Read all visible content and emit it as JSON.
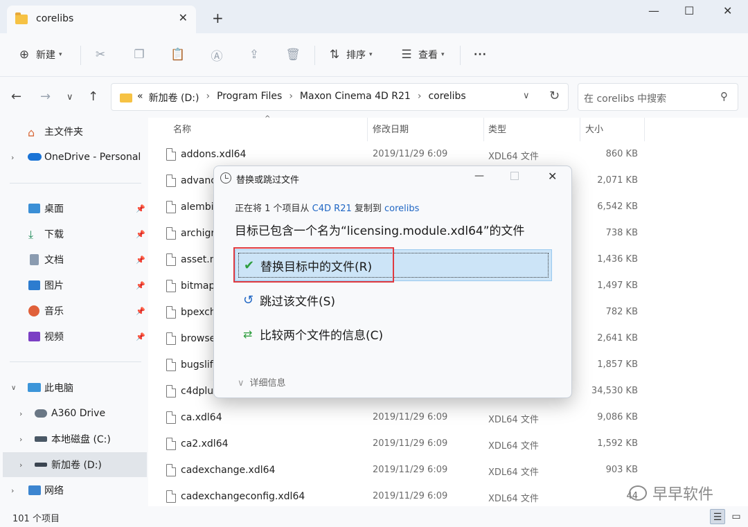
{
  "window": {
    "tab_title": "corelibs",
    "tab_close": "✕",
    "new_tab": "+",
    "min": "—",
    "max": "☐",
    "close": "✕"
  },
  "toolbar": {
    "new_label": "新建",
    "sort_label": "排序",
    "view_label": "查看",
    "more": "···"
  },
  "address": {
    "prefix": "«",
    "crumbs": [
      "新加卷 (D:)",
      "Program Files",
      "Maxon Cinema 4D R21",
      "corelibs"
    ],
    "search_placeholder": "在 corelibs 中搜索"
  },
  "sidebar": {
    "home": "主文件夹",
    "onedrive": "OneDrive - Personal",
    "quick": [
      "桌面",
      "下载",
      "文档",
      "图片",
      "音乐",
      "视频"
    ],
    "this_pc": "此电脑",
    "drives": [
      "A360 Drive",
      "本地磁盘 (C:)",
      "新加卷 (D:)"
    ],
    "network": "网络"
  },
  "columns": {
    "name": "名称",
    "date": "修改日期",
    "type": "类型",
    "size": "大小"
  },
  "files": [
    {
      "name": "addons.xdl64",
      "date": "2019/11/29 6:09",
      "type": "XDL64 文件",
      "size": "860 KB"
    },
    {
      "name": "advanc",
      "date": "",
      "type": "",
      "size": "2,071 KB"
    },
    {
      "name": "alembi",
      "date": "",
      "type": "",
      "size": "6,542 KB"
    },
    {
      "name": "archigr",
      "date": "",
      "type": "",
      "size": "738 KB"
    },
    {
      "name": "asset.m",
      "date": "",
      "type": "",
      "size": "1,436 KB"
    },
    {
      "name": "bitmap",
      "date": "",
      "type": "",
      "size": "1,497 KB"
    },
    {
      "name": "bpexch",
      "date": "",
      "type": "",
      "size": "782 KB"
    },
    {
      "name": "browse",
      "date": "",
      "type": "",
      "size": "2,641 KB"
    },
    {
      "name": "bugslif",
      "date": "",
      "type": "",
      "size": "1,857 KB"
    },
    {
      "name": "c4dplug",
      "date": "",
      "type": "",
      "size": "34,530 KB"
    },
    {
      "name": "ca.xdl64",
      "date": "2019/11/29 6:09",
      "type": "XDL64 文件",
      "size": "9,086 KB"
    },
    {
      "name": "ca2.xdl64",
      "date": "2019/11/29 6:09",
      "type": "XDL64 文件",
      "size": "1,592 KB"
    },
    {
      "name": "cadexchange.xdl64",
      "date": "2019/11/29 6:09",
      "type": "XDL64 文件",
      "size": "903 KB"
    },
    {
      "name": "cadexchangeconfig.xdl64",
      "date": "2019/11/29 6:09",
      "type": "XDL64 文件",
      "size": "44"
    }
  ],
  "status": {
    "count": "101 个项目"
  },
  "watermark": "早早软件",
  "dialog": {
    "title": "替换或跳过文件",
    "line1_a": "正在将 1 个项目从 ",
    "line1_src": "C4D R21",
    "line1_b": " 复制到 ",
    "line1_dst": "corelibs",
    "line2": "目标已包含一个名为“licensing.module.xdl64”的文件",
    "opt_replace": "替换目标中的文件(R)",
    "opt_skip": "跳过该文件(S)",
    "opt_compare": "比较两个文件的信息(C)",
    "more_details": "详细信息"
  },
  "colors": {
    "accent": "#1f66c4",
    "selection": "#cce4f7",
    "highlight_box": "#e0393f",
    "check": "#2e9e3e"
  }
}
